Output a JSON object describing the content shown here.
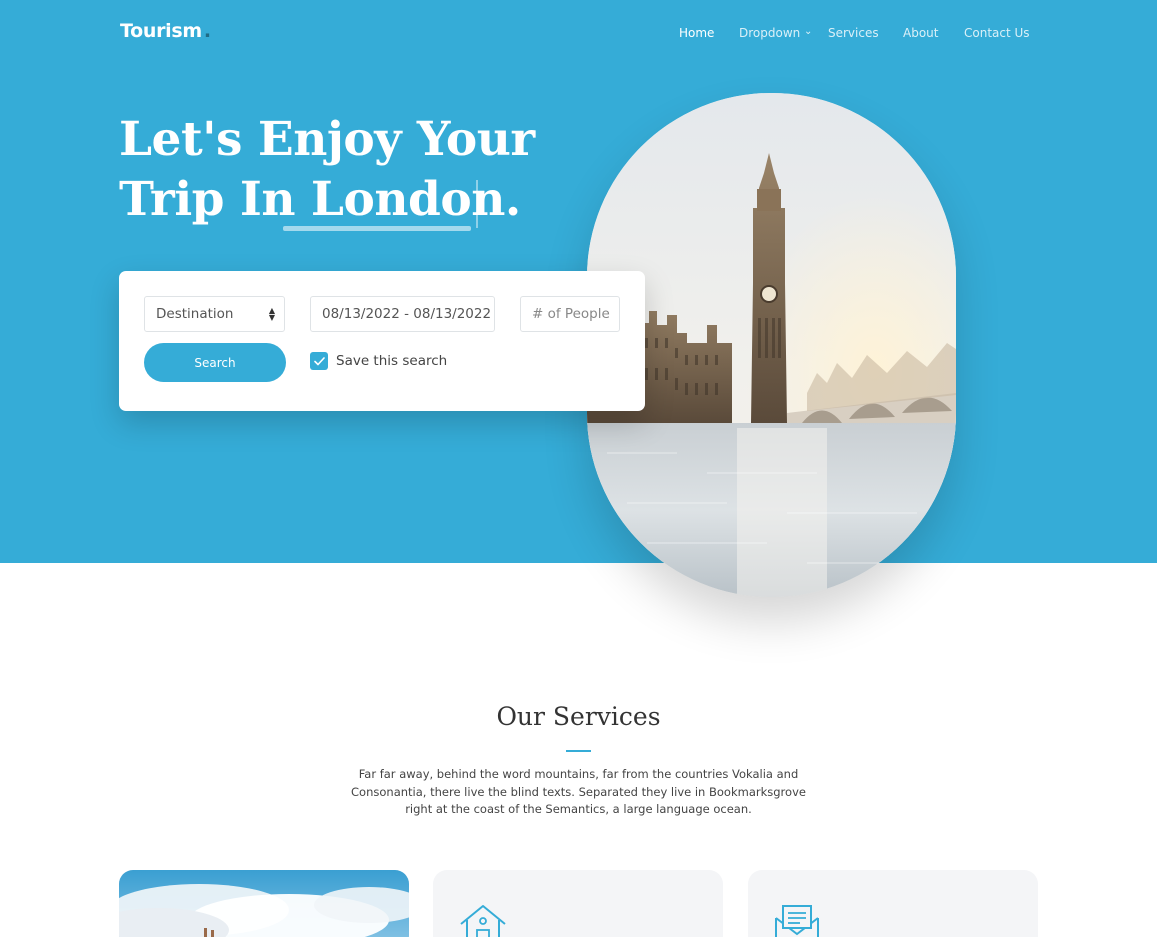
{
  "brand": {
    "name": "Tourism",
    "dot": "."
  },
  "nav": {
    "items": [
      {
        "label": "Home",
        "active": true
      },
      {
        "label": "Dropdown",
        "active": false
      },
      {
        "label": "Services",
        "active": false
      },
      {
        "label": "About",
        "active": false
      },
      {
        "label": "Contact Us",
        "active": false
      }
    ]
  },
  "hero": {
    "line1": "Let's Enjoy Your",
    "line2_prefix": "Trip In ",
    "line2_highlight": "London.",
    "background": "#35acd7"
  },
  "search": {
    "destination": "Destination",
    "dates": "08/13/2022 - 08/13/2022",
    "people_placeholder": "# of People",
    "button": "Search",
    "save_label": "Save this search",
    "save_checked": true
  },
  "services": {
    "title": "Our Services",
    "description": "Far far away, behind the word mountains, far from the countries Vokalia and Consonantia, there live the blind texts. Separated they live in Bookmarksgrove right at the coast of the Semantics, a large language ocean.",
    "cards": [
      {
        "icon": "photo"
      },
      {
        "icon": "house-icon"
      },
      {
        "icon": "newsletter-icon"
      }
    ]
  },
  "colors": {
    "accent": "#35acd7",
    "white": "#ffffff"
  }
}
